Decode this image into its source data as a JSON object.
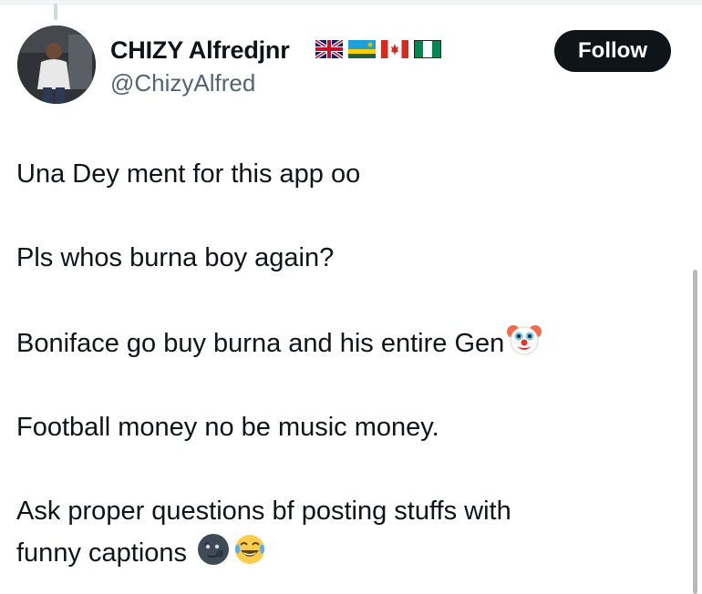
{
  "profile": {
    "display_name": "CHIZY Alfredjnr",
    "handle": "@ChizyAlfred",
    "flags": [
      "uk-flag-icon",
      "rwanda-flag-icon",
      "canada-flag-icon",
      "nigeria-flag-icon"
    ]
  },
  "actions": {
    "follow_label": "Follow"
  },
  "tweet": {
    "line1": "Una Dey ment for this app oo",
    "line2": "Pls whos burna boy again?",
    "line3": "Boniface go buy burna and his entire Gen",
    "line3_emoji": "clown-face-icon",
    "line4": "Football money no be music money.",
    "line5": "Ask proper questions bf posting stuffs with",
    "line6": "funny captions",
    "line6_emojis": [
      "new-moon-face-icon",
      "tears-of-joy-icon"
    ]
  },
  "colors": {
    "text": "#0f1419",
    "secondary_text": "#536471",
    "button_bg": "#0f1419",
    "button_text": "#ffffff"
  }
}
